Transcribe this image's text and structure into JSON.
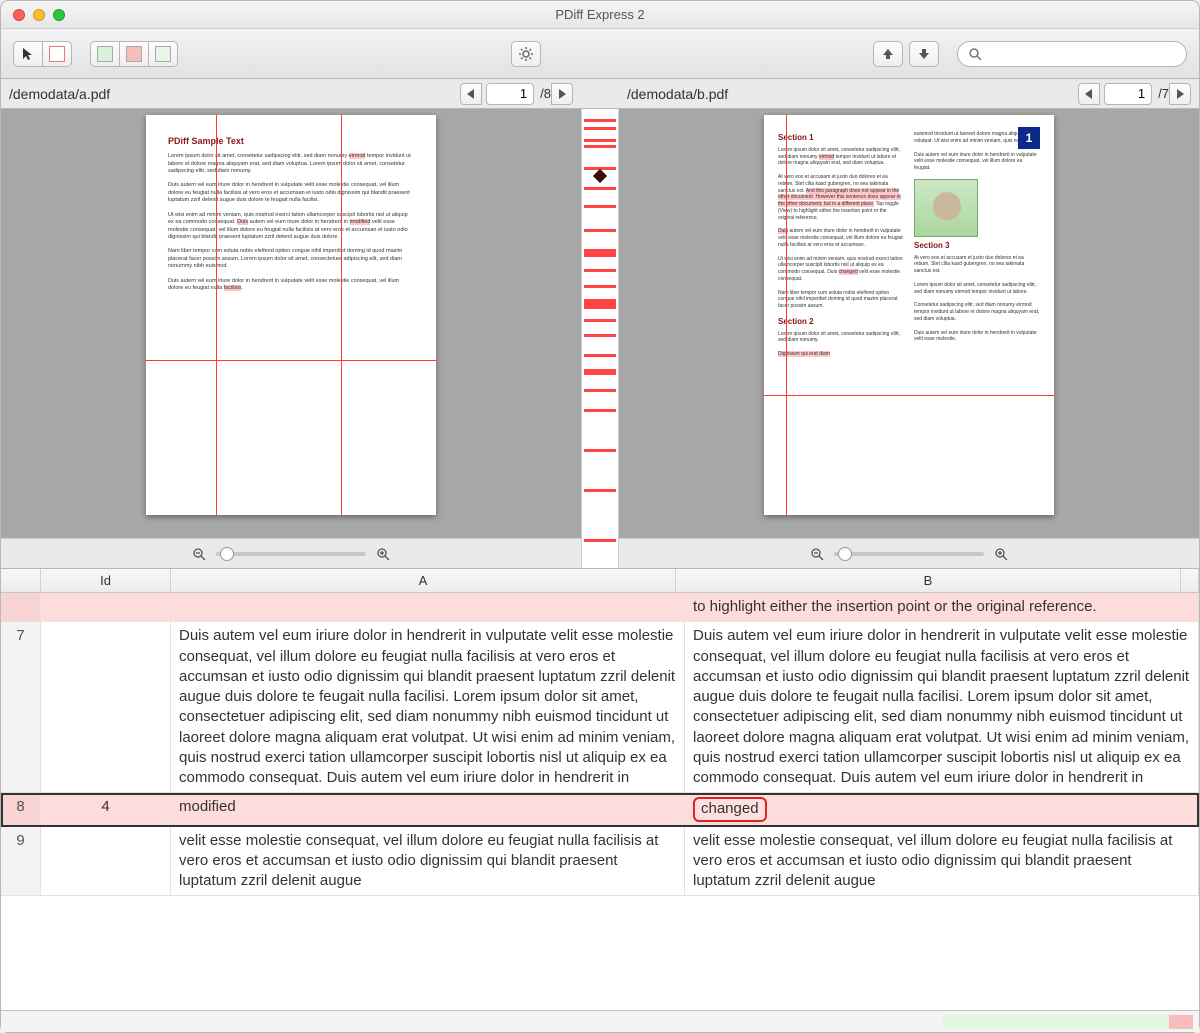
{
  "app": {
    "title": "PDiff Express 2"
  },
  "toolbar": {
    "cursor": "cursor-tool",
    "highlight": "highlight-tool",
    "filter_all": "show-all",
    "filter_diff": "show-diff",
    "filter_same": "show-same",
    "settings": "settings",
    "prev": "previous-diff",
    "next": "next-diff",
    "search_placeholder": ""
  },
  "paneA": {
    "path": "/demodata/a.pdf",
    "page_current": "1",
    "page_total": "/8",
    "doc_title": "PDiff Sample Text"
  },
  "paneB": {
    "path": "/demodata/b.pdf",
    "page_current": "1",
    "page_total": "/7",
    "section1": "Section 1",
    "section2": "Section 2",
    "section3": "Section 3",
    "page_badge": "1"
  },
  "table": {
    "headers": {
      "rownum": "",
      "id": "Id",
      "a": "A",
      "b": "B"
    },
    "rows": [
      {
        "rownum": "",
        "id": "",
        "a": "",
        "b": "to highlight either the insertion point or the original reference.",
        "pink": true
      },
      {
        "rownum": "7",
        "id": "",
        "a": "Duis autem vel eum iriure dolor in hendrerit in vulputate velit esse molestie consequat, vel illum dolore eu feugiat nulla facilisis at vero eros et accumsan et iusto odio dignissim qui blandit praesent luptatum zzril delenit augue duis dolore te feugait nulla facilisi. Lorem ipsum dolor sit amet, consectetuer adipiscing elit, sed diam nonummy nibh euismod tincidunt ut laoreet dolore magna aliquam erat volutpat. Ut wisi enim ad minim veniam, quis nostrud exerci tation ullamcorper suscipit lobortis nisl ut aliquip ex ea commodo consequat. Duis autem vel eum iriure dolor in hendrerit in",
        "b": "Duis autem vel eum iriure dolor in hendrerit in vulputate velit esse molestie consequat, vel illum dolore eu feugiat nulla facilisis at vero eros et accumsan et iusto odio dignissim qui blandit praesent luptatum zzril delenit augue duis dolore te feugait nulla facilisi. Lorem ipsum dolor sit amet, consectetuer adipiscing elit, sed diam nonummy nibh euismod tincidunt ut laoreet dolore magna aliquam erat volutpat. Ut wisi enim ad minim veniam, quis nostrud exerci tation ullamcorper suscipit lobortis nisl ut aliquip ex ea commodo consequat. Duis autem vel eum iriure dolor in hendrerit in",
        "pink": false
      },
      {
        "rownum": "8",
        "id": "4",
        "a": "modified",
        "b": "changed",
        "pink": true,
        "selected": true,
        "highlight_b": true
      },
      {
        "rownum": "9",
        "id": "",
        "a": "velit esse molestie consequat, vel illum dolore eu feugiat nulla facilisis at vero eros et accumsan et iusto odio dignissim qui blandit praesent luptatum zzril delenit augue",
        "b": "velit esse molestie consequat, vel illum dolore eu feugiat nulla facilisis at vero eros et accumsan et iusto odio dignissim qui blandit praesent luptatum zzril delenit augue",
        "pink": false
      }
    ]
  }
}
